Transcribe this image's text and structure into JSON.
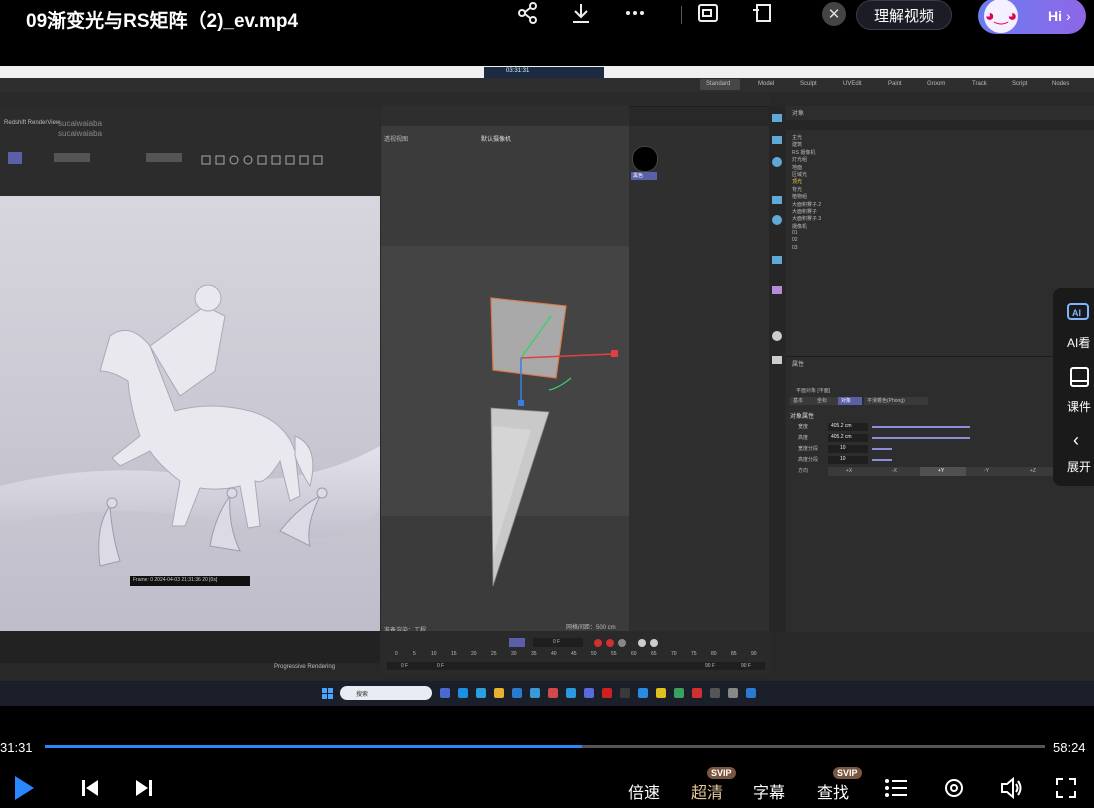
{
  "header": {
    "title": "09渐变光与RS矩阵（2)_ev.mp4",
    "understand_label": "理解视频",
    "hi_label": "Hi",
    "icons": [
      "share-icon",
      "download-icon",
      "more-icon",
      "pip-icon",
      "popout-icon",
      "close-icon"
    ]
  },
  "app": {
    "top_tabs": [
      "Standard",
      "Model",
      "Sculpt",
      "UVEdit",
      "Paint",
      "Groom",
      "Track",
      "Script",
      "Nodes"
    ],
    "redshift_label": "Redshift RenderView",
    "watermark_1": "sucaiwaiaba",
    "watermark_2": "sucaiwaiaba",
    "timer": "03:31:31",
    "frame_status": "Frame: 0  2024-04-03  21:31:36  20 [0s]",
    "progressive": "Progressive Rendering",
    "viewport_label": "透视视图",
    "camera_label": "默认摄像机",
    "grid_label": "网格间距：500 cm",
    "object_tab": "对象",
    "attr_tab": "属性",
    "attr_section": "对象属性",
    "plane_title": "平面对象 [平面]",
    "phong_tab": "平滑着色(Phong)",
    "attr_tabs": [
      "基本",
      "坐标",
      "对象"
    ],
    "attrs": [
      {
        "label": "宽度",
        "value": "405.2 cm"
      },
      {
        "label": "高度",
        "value": "405.2 cm"
      },
      {
        "label": "宽度分段",
        "value": "10"
      },
      {
        "label": "高度分段",
        "value": "10"
      }
    ],
    "direction_label": "方向",
    "direction_options": [
      "+X",
      "-X",
      "+Y",
      "-Y",
      "+Z",
      "-Z"
    ],
    "objects": [
      "主光",
      "建筑",
      "RS 摄像机",
      "灯光组",
      "地面",
      "区域光",
      "顶光",
      "背光",
      "植物组",
      "大面积雾子.2",
      "大面积雾子",
      "大面积雾子.3",
      "摄像机",
      "01",
      "02",
      "03"
    ],
    "material_label": "黑色",
    "timeline_frame": "0 F",
    "timeline_ticks": [
      "0",
      "5",
      "10",
      "15",
      "20",
      "25",
      "30",
      "35",
      "40",
      "45",
      "50",
      "55",
      "60",
      "65",
      "70",
      "75",
      "80",
      "85",
      "90"
    ],
    "frame_start": "0 F",
    "frame_end": "90 F",
    "frame_end2": "90 F",
    "status_text": "准备渲染：工程",
    "search_placeholder": "搜索"
  },
  "side_panel": {
    "items": [
      {
        "label": "AI看",
        "icon": "ai-icon"
      },
      {
        "label": "课件",
        "icon": "courseware-icon"
      },
      {
        "label": "展开",
        "icon": "chevron-left-icon"
      }
    ]
  },
  "player": {
    "current_time": "31:31",
    "total_time": "58:24",
    "progress": 0.537,
    "speed_label": "倍速",
    "quality_label": "超清",
    "subtitle_label": "字幕",
    "search_label": "查找",
    "svip_badge": "SVIP"
  },
  "colors": {
    "accent": "#2a86ff",
    "brand": "#7c6cf0"
  }
}
